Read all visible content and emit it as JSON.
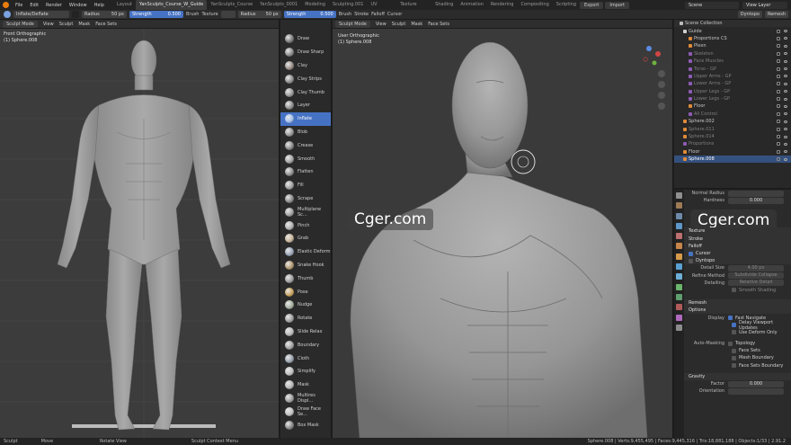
{
  "menu": [
    "File",
    "Edit",
    "Render",
    "Window",
    "Help"
  ],
  "workspace_tabs": [
    {
      "label": "Layout",
      "active": false
    },
    {
      "label": "YanSculpts_Course_W_Guide",
      "active": true
    },
    {
      "label": "YanSculpts_Course",
      "active": false
    },
    {
      "label": "YanSculpts_0001",
      "active": false
    },
    {
      "label": "Modeling",
      "active": false
    },
    {
      "label": "Sculpting.001",
      "active": false
    },
    {
      "label": "UV Editing",
      "active": false
    },
    {
      "label": "Texture Paint",
      "active": false
    },
    {
      "label": "Shading",
      "active": false
    },
    {
      "label": "Animation",
      "active": false
    },
    {
      "label": "Rendering",
      "active": false
    },
    {
      "label": "Compositing",
      "active": false
    },
    {
      "label": "Scripting",
      "active": false
    }
  ],
  "top_right": {
    "export": "Export",
    "import": "Import",
    "scene": "Scene",
    "view_layer": "View Layer"
  },
  "tool_header": {
    "brush_name": "Inflate/Deflate",
    "radius_label": "Radius",
    "radius_value": "50 px",
    "strength_label": "Strength",
    "strength_value": "0.500",
    "brush_menu": "Brush",
    "texture_menu": "Texture",
    "radius_value_2": "50 px",
    "strength_value_2": "0.500",
    "brush_menu_2": "Brush",
    "stroke_menu": "Stroke",
    "falloff_menu": "Falloff",
    "cursor_menu": "Cursor",
    "dyntopo": "Dyntopo",
    "remesh": "Remesh"
  },
  "left_viewport": {
    "header": [
      "Sculpt Mode",
      "View",
      "Sculpt",
      "Mask",
      "Face Sets"
    ],
    "title": "Front Orthographic",
    "subtitle": "(1) Sphere.008"
  },
  "right_viewport": {
    "header": [
      "Sculpt Mode",
      "View",
      "Sculpt",
      "Mask",
      "Face Sets"
    ],
    "title": "User Orthographic",
    "subtitle": "(1) Sphere.008"
  },
  "brushes": [
    {
      "label": "Draw",
      "active": false
    },
    {
      "label": "Draw Sharp",
      "active": false
    },
    {
      "label": "Clay",
      "active": false
    },
    {
      "label": "Clay Strips",
      "active": false
    },
    {
      "label": "Clay Thumb",
      "active": false
    },
    {
      "label": "Layer",
      "active": false
    },
    {
      "label": "Inflate",
      "active": true
    },
    {
      "label": "Blob",
      "active": false
    },
    {
      "label": "Crease",
      "active": false
    },
    {
      "label": "Smooth",
      "active": false
    },
    {
      "label": "Flatten",
      "active": false
    },
    {
      "label": "Fill",
      "active": false
    },
    {
      "label": "Scrape",
      "active": false
    },
    {
      "label": "Multiplane Sc...",
      "active": false
    },
    {
      "label": "Pinch",
      "active": false
    },
    {
      "label": "Grab",
      "active": false
    },
    {
      "label": "Elastic Deform",
      "active": false
    },
    {
      "label": "Snake Hook",
      "active": false
    },
    {
      "label": "Thumb",
      "active": false
    },
    {
      "label": "Pose",
      "active": false
    },
    {
      "label": "Nudge",
      "active": false
    },
    {
      "label": "Rotate",
      "active": false
    },
    {
      "label": "Slide Relax",
      "active": false
    },
    {
      "label": "Boundary",
      "active": false
    },
    {
      "label": "Cloth",
      "active": false
    },
    {
      "label": "Simplify",
      "active": false
    },
    {
      "label": "Mask",
      "active": false
    },
    {
      "label": "Multires Displ...",
      "active": false
    },
    {
      "label": "Draw Face Se...",
      "active": false
    },
    {
      "label": "Box Mask",
      "active": false
    }
  ],
  "outliner": {
    "header": "Scene Collection",
    "rows": [
      {
        "label": "Guide",
        "indent": 1,
        "dim": false,
        "sel": false,
        "color": "#d0d0d0"
      },
      {
        "label": "Proportions CS",
        "indent": 2,
        "dim": false,
        "sel": false,
        "color": "#e08a3a"
      },
      {
        "label": "Plexn",
        "indent": 2,
        "dim": false,
        "sel": false,
        "color": "#e08a3a"
      },
      {
        "label": "Skeleton",
        "indent": 2,
        "dim": true,
        "sel": false,
        "color": "#8d5bb5"
      },
      {
        "label": "Face Muscles",
        "indent": 2,
        "dim": true,
        "sel": false,
        "color": "#8d5bb5"
      },
      {
        "label": "Torso - GP",
        "indent": 2,
        "dim": true,
        "sel": false,
        "color": "#8d5bb5"
      },
      {
        "label": "Upper Arms - GP",
        "indent": 2,
        "dim": true,
        "sel": false,
        "color": "#8d5bb5"
      },
      {
        "label": "Lower Arms - GP",
        "indent": 2,
        "dim": true,
        "sel": false,
        "color": "#8d5bb5"
      },
      {
        "label": "Upper Legs - GP",
        "indent": 2,
        "dim": true,
        "sel": false,
        "color": "#8d5bb5"
      },
      {
        "label": "Lower Legs - GP",
        "indent": 2,
        "dim": true,
        "sel": false,
        "color": "#8d5bb5"
      },
      {
        "label": "Floor",
        "indent": 2,
        "dim": false,
        "sel": false,
        "color": "#e08a3a"
      },
      {
        "label": "All Control",
        "indent": 2,
        "dim": true,
        "sel": false,
        "color": "#8d5bb5"
      },
      {
        "label": "Sphere.002",
        "indent": 1,
        "dim": false,
        "sel": false,
        "color": "#e08a3a"
      },
      {
        "label": "Sphere.011",
        "indent": 1,
        "dim": true,
        "sel": false,
        "color": "#e08a3a"
      },
      {
        "label": "Sphere.014",
        "indent": 1,
        "dim": true,
        "sel": false,
        "color": "#e08a3a"
      },
      {
        "label": "Proportions",
        "indent": 1,
        "dim": true,
        "sel": false,
        "color": "#8d5bb5"
      },
      {
        "label": "Floor",
        "indent": 1,
        "dim": false,
        "sel": false,
        "color": "#e08a3a"
      },
      {
        "label": "Sphere.008",
        "indent": 1,
        "dim": false,
        "sel": true,
        "color": "#e08a3a"
      }
    ]
  },
  "properties": {
    "normal_radius": "Normal Radius",
    "hardness_label": "Hardness",
    "hardness_value": "0.000",
    "texture": "Texture",
    "stroke": "Stroke",
    "falloff": "Falloff",
    "cursor": "Cursor",
    "dyntopo": "Dyntopo",
    "detail_size_label": "Detail Size",
    "detail_size_value": "4.00 px",
    "refine_label": "Refine Method",
    "refine_value": "Subdivide Collapse",
    "detailing_label": "Detailing",
    "detailing_value": "Relative Detail",
    "smooth_shading": "Smooth Shading",
    "remesh": "Remesh",
    "options": "Options",
    "display_label": "Display",
    "fast_navigate": "Fast Navigate",
    "delay_updates": "Delay Viewport Updates",
    "use_deform_only": "Use Deform Only",
    "auto_masking_label": "Auto-Masking",
    "topology": "Topology",
    "face_sets": "Face Sets",
    "mesh_boundary": "Mesh Boundary",
    "face_sets_boundary": "Face Sets Boundary",
    "gravity": "Gravity",
    "factor_label": "Factor",
    "factor_value": "0.000",
    "orientation_label": "Orientation"
  },
  "status": {
    "sculpt": "Sculpt",
    "move": "Move",
    "rotate_view": "Rotate View",
    "context_menu": "Sculpt Context Menu",
    "stats": "Sphere.008 | Verts:9,455,495 | Faces:9,445,316 | Tris:18,881,188 | Objects:1/33 | 2.91.2"
  },
  "watermark": "Cger.com",
  "colors": {
    "accent": "#4672c4",
    "object_orange": "#e08a3a",
    "gp_purple": "#8d5bb5"
  }
}
